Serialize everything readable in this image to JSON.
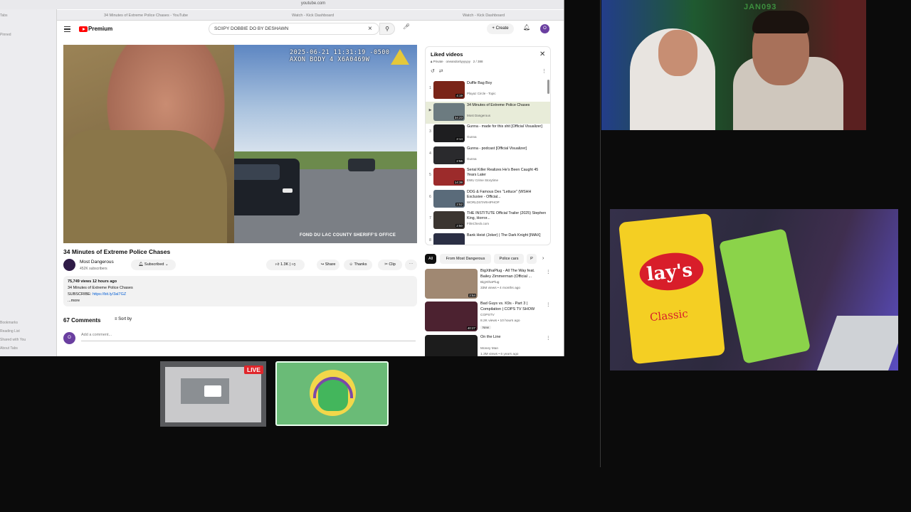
{
  "browser": {
    "url": "youtube.com",
    "tabs": [
      "34 Minutes of Extreme Police Chases - YouTube",
      "Watch - Kick Dashboard",
      "Watch - Kick Dashboard"
    ],
    "sidebar_items": [
      "Tabs",
      "Pinned",
      "Bookmarks",
      "Reading List",
      "Shared with You",
      "About Tabs"
    ]
  },
  "header": {
    "logo": "Premium",
    "search_value": "SCIIPY DOBBIE DO BY DESHAWN",
    "create_label": "Create",
    "avatar_letter": "O"
  },
  "player": {
    "timestamp_line1": "2025-06-21 11:31:19 -0500",
    "timestamp_line2": "AXON BODY 4 X6A0469W",
    "footer": "FOND DU LAC COUNTY SHERIFF'S OFFICE"
  },
  "video": {
    "title": "34 Minutes of Extreme Police Chases",
    "channel": "Most Dangerous",
    "subscribers": "452K subscribers",
    "subscribed_label": "Subscribed",
    "likes": "1.3K",
    "share_label": "Share",
    "thanks_label": "Thanks",
    "clip_label": "Clip",
    "views_line": "75,749 views  12 hours ago",
    "desc_line1": "34 Minutes of Extreme Police Chases",
    "desc_subscribe": "SUBSCRIBE: ",
    "desc_link": "https://bit.ly/3al7GZ",
    "desc_more": "...more"
  },
  "comments": {
    "count_label": "67 Comments",
    "sort_label": "Sort by",
    "avatar_letter": "O",
    "placeholder": "Add a comment..."
  },
  "playlist": {
    "title": "Liked videos",
    "privacy": "Private",
    "owner": "oneandonlyyyyyy",
    "position": "2 / 388",
    "items": [
      {
        "num": "1",
        "title": "Duffle Bag Boy",
        "channel": "Playaz Circle - Topic",
        "duration": "4:19",
        "color": "#7a2418"
      },
      {
        "num": "▶",
        "title": "34 Minutes of Extreme Police Chases",
        "channel": "Most Dangerous",
        "duration": "34:23",
        "color": "#6c7b80"
      },
      {
        "num": "3",
        "title": "Gunna - made for this shit [Official Visualizer]",
        "channel": "Gunna",
        "duration": "2:14",
        "color": "#1e1e20"
      },
      {
        "num": "4",
        "title": "Gunna - podcast [Official Visualizer]",
        "channel": "Gunna",
        "duration": "2:56",
        "color": "#2a2a2d"
      },
      {
        "num": "5",
        "title": "Serial Killer Realizes He's Been Caught 45 Years Later",
        "channel": "EWU Crime Storytime",
        "duration": "14:38",
        "color": "#9c2b2b"
      },
      {
        "num": "6",
        "title": "DDG & Famous Dex \"Lettuce\" (WSHH Exclusive - Official...",
        "channel": "WORLDSTARHIPHOP",
        "duration": "2:52",
        "color": "#5a6b7a"
      },
      {
        "num": "7",
        "title": "THE INSTITUTE Official Trailer (2025) Stephen King, Horror...",
        "channel": "FilmCheck.com",
        "duration": "2:50",
        "color": "#3b3530"
      },
      {
        "num": "8",
        "title": "Bank Heist (Joker) | The Dark Knight [IMAX]",
        "channel": "",
        "duration": "",
        "color": "#2b2f44"
      }
    ]
  },
  "chips": [
    "All",
    "From Most Dangerous",
    "Police cars",
    "P"
  ],
  "recommendations": [
    {
      "title": "BigXthaPlug - All The Way feat. Bailey Zimmerman (Official ...",
      "channel": "BigXthaPlug",
      "meta": "33M views • 4 months ago",
      "duration": "2:54",
      "color": "#a08872",
      "new": ""
    },
    {
      "title": "Bad Guys vs. K9s - Part 3 | Compilation | COPS TV SHOW",
      "channel": "COPSTV",
      "meta": "8.2K views • 10 hours ago",
      "duration": "40:27",
      "color": "#4c2230",
      "new": "New"
    },
    {
      "title": "On the Line",
      "channel": "Money Man",
      "meta": "1.3M views • 6 years ago",
      "duration": "",
      "color": "#1c1c1c",
      "new": ""
    }
  ],
  "stream": {
    "live_label": "LIVE"
  },
  "webcam": {
    "wall_text": "JAN093"
  },
  "lays": {
    "brand": "lay's",
    "flavor": "Classic"
  }
}
